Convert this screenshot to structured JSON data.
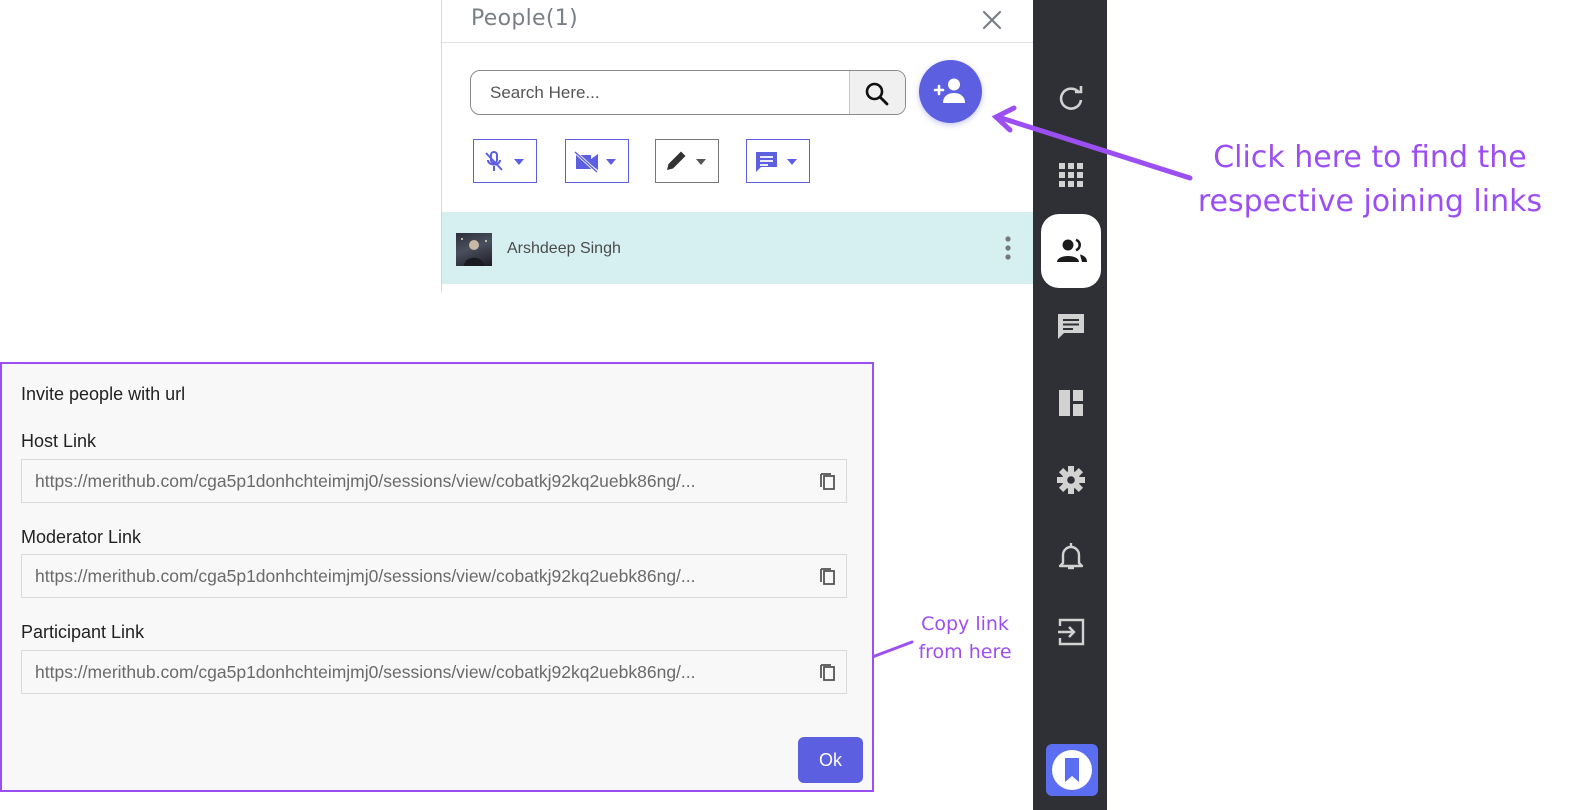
{
  "people_panel": {
    "title": "People(1)",
    "search": {
      "placeholder": "Search Here..."
    },
    "filters": [
      {
        "icon": "mic-off-icon"
      },
      {
        "icon": "video-off-icon"
      },
      {
        "icon": "pencil-icon"
      },
      {
        "icon": "chat-icon"
      }
    ],
    "participants": [
      {
        "name": "Arshdeep Singh"
      }
    ]
  },
  "toolbar": {
    "items": [
      "refresh-icon",
      "apps-grid-icon",
      "people-icon",
      "chat-icon",
      "layout-icon",
      "settings-icon",
      "bell-icon",
      "exit-icon"
    ],
    "active": "people-icon"
  },
  "annotations": {
    "main_line1": "Click here to find the",
    "main_line2": "respective joining links",
    "copy_line1": "Copy link",
    "copy_line2": "from here"
  },
  "invite_dialog": {
    "title": "Invite people with url",
    "links": [
      {
        "label": "Host Link",
        "url": "https://merithub.com/cga5p1donhchteimjmj0/sessions/view/cobatkj92kq2uebk86ng/..."
      },
      {
        "label": "Moderator Link",
        "url": "https://merithub.com/cga5p1donhchteimjmj0/sessions/view/cobatkj92kq2uebk86ng/..."
      },
      {
        "label": "Participant Link",
        "url": "https://merithub.com/cga5p1donhchteimjmj0/sessions/view/cobatkj92kq2uebk86ng/..."
      }
    ],
    "ok_label": "Ok"
  },
  "colors": {
    "accent": "#5b5fe0",
    "annotation": "#9b4ff2",
    "toolbar_bg": "#2f3035",
    "participant_row_bg": "#d6f0f2"
  }
}
